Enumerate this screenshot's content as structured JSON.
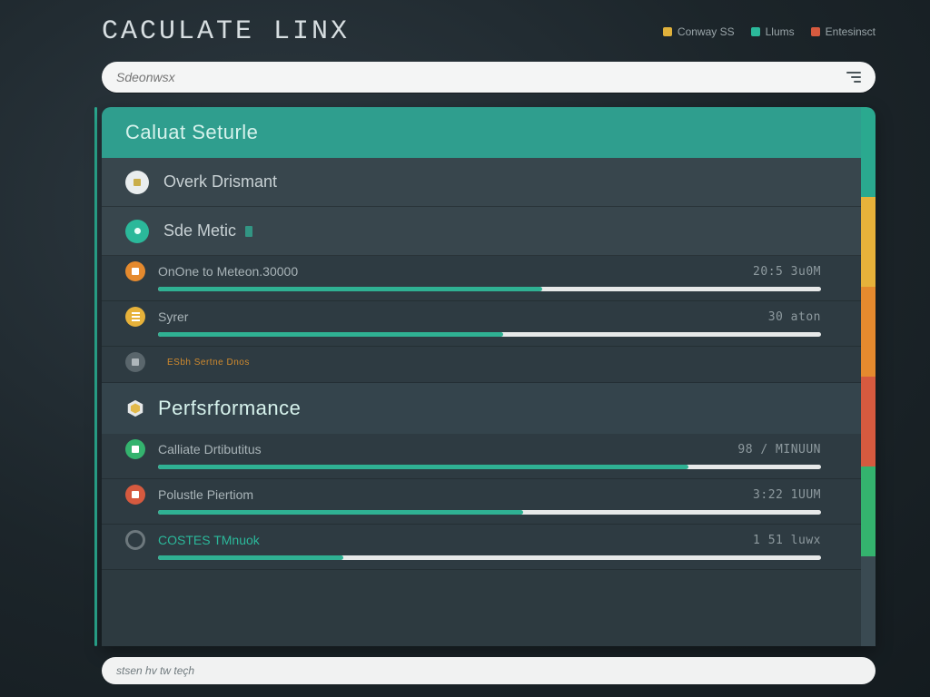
{
  "header": {
    "title": "CACULATE LINX",
    "legend": [
      {
        "label": "Conway SS",
        "color": "#e0b13b"
      },
      {
        "label": "Llums",
        "color": "#2bb89a"
      },
      {
        "label": "Entesinsct",
        "color": "#d65a3f"
      }
    ]
  },
  "search": {
    "placeholder": "Sdeonwsx"
  },
  "colors": {
    "teal": "#2f9e8e",
    "edge_tabs": [
      "#2aa98f",
      "#e7b23a",
      "#e58a2e",
      "#d65a3f",
      "#34b36e",
      "#3a4a52"
    ]
  },
  "sections": [
    {
      "kind": "header",
      "title": "Caluat Seturle",
      "style": "teal"
    },
    {
      "kind": "row",
      "icon_color": "disc-white",
      "glyph": "glyph-sq",
      "label": "Overk Drismant",
      "value": ""
    },
    {
      "kind": "row",
      "icon_color": "disc-teal",
      "glyph": "glyph-dot",
      "label": "Sde Metic",
      "badge": true,
      "value": ""
    },
    {
      "kind": "metric",
      "icon_color": "disc-orange",
      "glyph": "glyph-sq",
      "label": "OnOne to Meteon.30000",
      "value": "20:5 3u0M",
      "progress": 58
    },
    {
      "kind": "metric",
      "icon_color": "disc-amber",
      "glyph": "glyph-bars",
      "label": "Syrer",
      "value": "30 aton",
      "progress": 52
    },
    {
      "kind": "metric",
      "short": true,
      "icon_color": "disc-grey",
      "glyph": "glyph-sq",
      "label": "",
      "note": "ESbh Sertne Dnos",
      "value": "",
      "progress": 0,
      "hide_bar": true
    },
    {
      "kind": "header",
      "title": "Perfsrformance",
      "style": "secondary",
      "hex_icon": true
    },
    {
      "kind": "metric",
      "icon_color": "disc-green",
      "glyph": "glyph-sq",
      "label": "Calliate Drtibutitus",
      "value": "98 / MINUUN",
      "progress": 80
    },
    {
      "kind": "metric",
      "icon_color": "disc-red",
      "glyph": "glyph-sq",
      "label": "Polustle Piertiom",
      "value": "3:22 1UUM",
      "progress": 55
    },
    {
      "kind": "metric",
      "icon_color": "disc-ring",
      "glyph": "",
      "label": "COSTES TMnuok",
      "label_tint": "#2bb89a",
      "value": "1 51 luwx",
      "progress": 28
    }
  ],
  "bottom": {
    "status": "stsen hv tw teçh"
  }
}
